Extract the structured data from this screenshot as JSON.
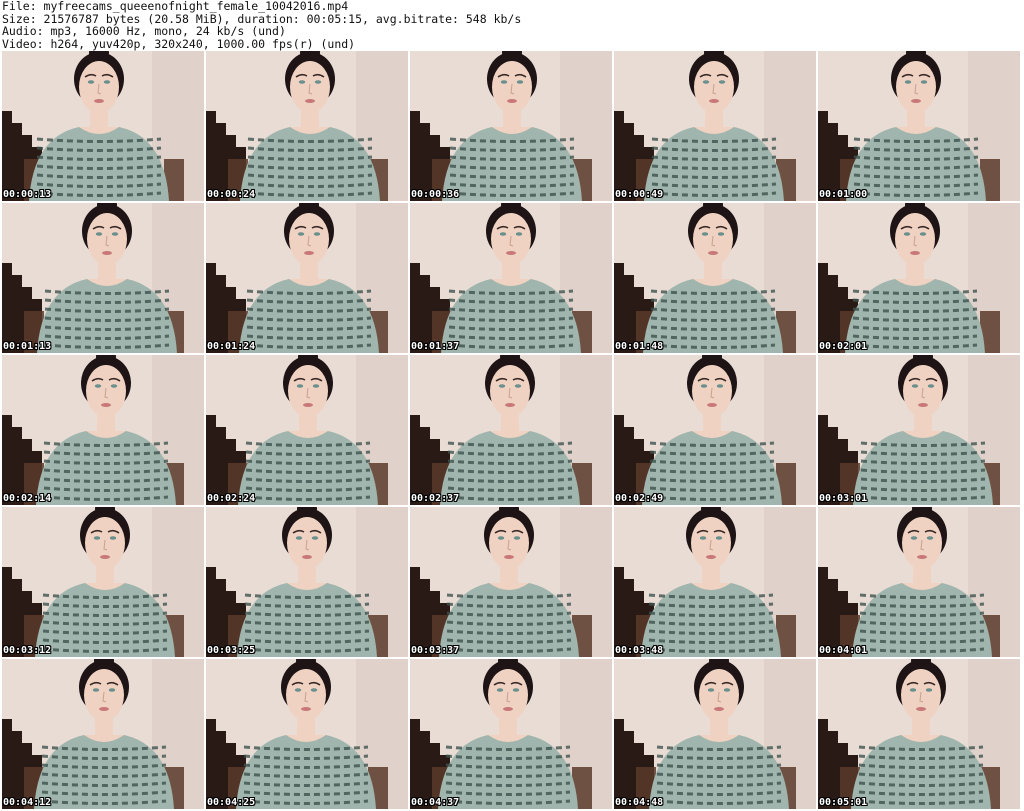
{
  "header": {
    "file_line": "File: myfreecams_queeenofnight_female_10042016.mp4",
    "size_line": "Size: 21576787 bytes (20.58 MiB), duration: 00:05:15, avg.bitrate: 548 kb/s",
    "audio_line": "Audio: mp3, 16000 Hz, mono, 24 kb/s (und)",
    "video_line": "Video: h264, yuv420p, 320x240, 1000.00 fps(r) (und)"
  },
  "colors": {
    "wall": "#e8dcd4",
    "wall_shadow": "#d8c8bf",
    "stairs": "#2a1a16",
    "skin": "#efd2c2",
    "hair": "#1e1416",
    "sweater_base": "#9fb5ad",
    "sweater_dark": "#3f524e",
    "chair": "#5b3b2c"
  },
  "thumbnails": [
    {
      "time": "00:00:13"
    },
    {
      "time": "00:00:24"
    },
    {
      "time": "00:00:36"
    },
    {
      "time": "00:00:49"
    },
    {
      "time": "00:01:00"
    },
    {
      "time": "00:01:13"
    },
    {
      "time": "00:01:24"
    },
    {
      "time": "00:01:37"
    },
    {
      "time": "00:01:48"
    },
    {
      "time": "00:02:01"
    },
    {
      "time": "00:02:14"
    },
    {
      "time": "00:02:24"
    },
    {
      "time": "00:02:37"
    },
    {
      "time": "00:02:49"
    },
    {
      "time": "00:03:01"
    },
    {
      "time": "00:03:12"
    },
    {
      "time": "00:03:25"
    },
    {
      "time": "00:03:37"
    },
    {
      "time": "00:03:48"
    },
    {
      "time": "00:04:01"
    },
    {
      "time": "00:04:12"
    },
    {
      "time": "00:04:25"
    },
    {
      "time": "00:04:37"
    },
    {
      "time": "00:04:48"
    },
    {
      "time": "00:05:01"
    }
  ]
}
